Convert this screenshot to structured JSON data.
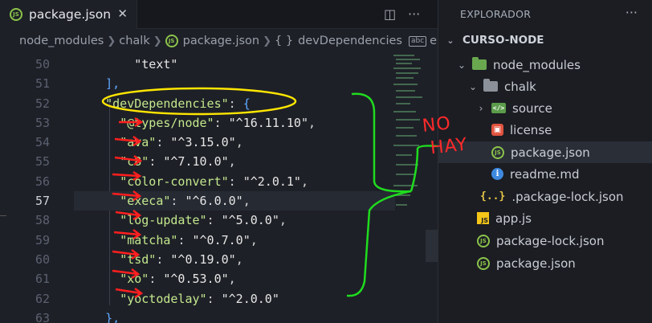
{
  "editor": {
    "tab": {
      "label": "package.json",
      "close": "✕"
    },
    "actions": {
      "split": "◫",
      "more": "···"
    },
    "breadcrumb": {
      "items": [
        "node_modules",
        "chalk",
        "package.json",
        "devDependencies"
      ],
      "braces": "{ }",
      "abc": "abc",
      "trailing": "e"
    },
    "line_numbers": [
      "50",
      "51",
      "52",
      "53",
      "54",
      "55",
      "56",
      "57",
      "58",
      "59",
      "60",
      "61",
      "62",
      "63"
    ],
    "active_line": "57",
    "code": {
      "l50": "\"text\"",
      "l51": "],",
      "l52_key": "\"devDependencies\"",
      "l52_colon": ": ",
      "l52_brace": "{",
      "deps": [
        {
          "name": "\"@types/node\"",
          "version": "\"^16.11.10\""
        },
        {
          "name": "\"ava\"",
          "version": "\"^3.15.0\""
        },
        {
          "name": "\"c8\"",
          "version": "\"^7.10.0\""
        },
        {
          "name": "\"color-convert\"",
          "version": "\"^2.0.1\""
        },
        {
          "name": "\"execa\"",
          "version": "\"^6.0.0\""
        },
        {
          "name": "\"log-update\"",
          "version": "\"^5.0.0\""
        },
        {
          "name": "\"matcha\"",
          "version": "\"^0.7.0\""
        },
        {
          "name": "\"tsd\"",
          "version": "\"^0.19.0\""
        },
        {
          "name": "\"xo\"",
          "version": "\"^0.53.0\""
        },
        {
          "name": "\"yoctodelay\"",
          "version": "\"^2.0.0\""
        }
      ],
      "l63": "},"
    }
  },
  "explorer": {
    "title": "EXPLORADOR",
    "more": "···",
    "root": "CURSO-NODE",
    "items": {
      "node_modules": "node_modules",
      "chalk": "chalk",
      "source": "source",
      "license": "license",
      "package_json_chalk": "package.json",
      "readme": "readme.md",
      "package_lock_hidden": ".package-lock.json",
      "app_js": "app.js",
      "package_lock": "package-lock.json",
      "package_json": "package.json"
    },
    "icons": {
      "js": "JS",
      "json": "JS",
      "info": "i",
      "license": "▣",
      "source": "</>",
      "braces": "{..}"
    }
  },
  "annotations": {
    "note_line1": "NO",
    "note_line2": "HAY",
    "highlight_color": "#ffe600",
    "arrow_color": "#ff1f1f",
    "bracket_color": "#1fdc1f"
  }
}
